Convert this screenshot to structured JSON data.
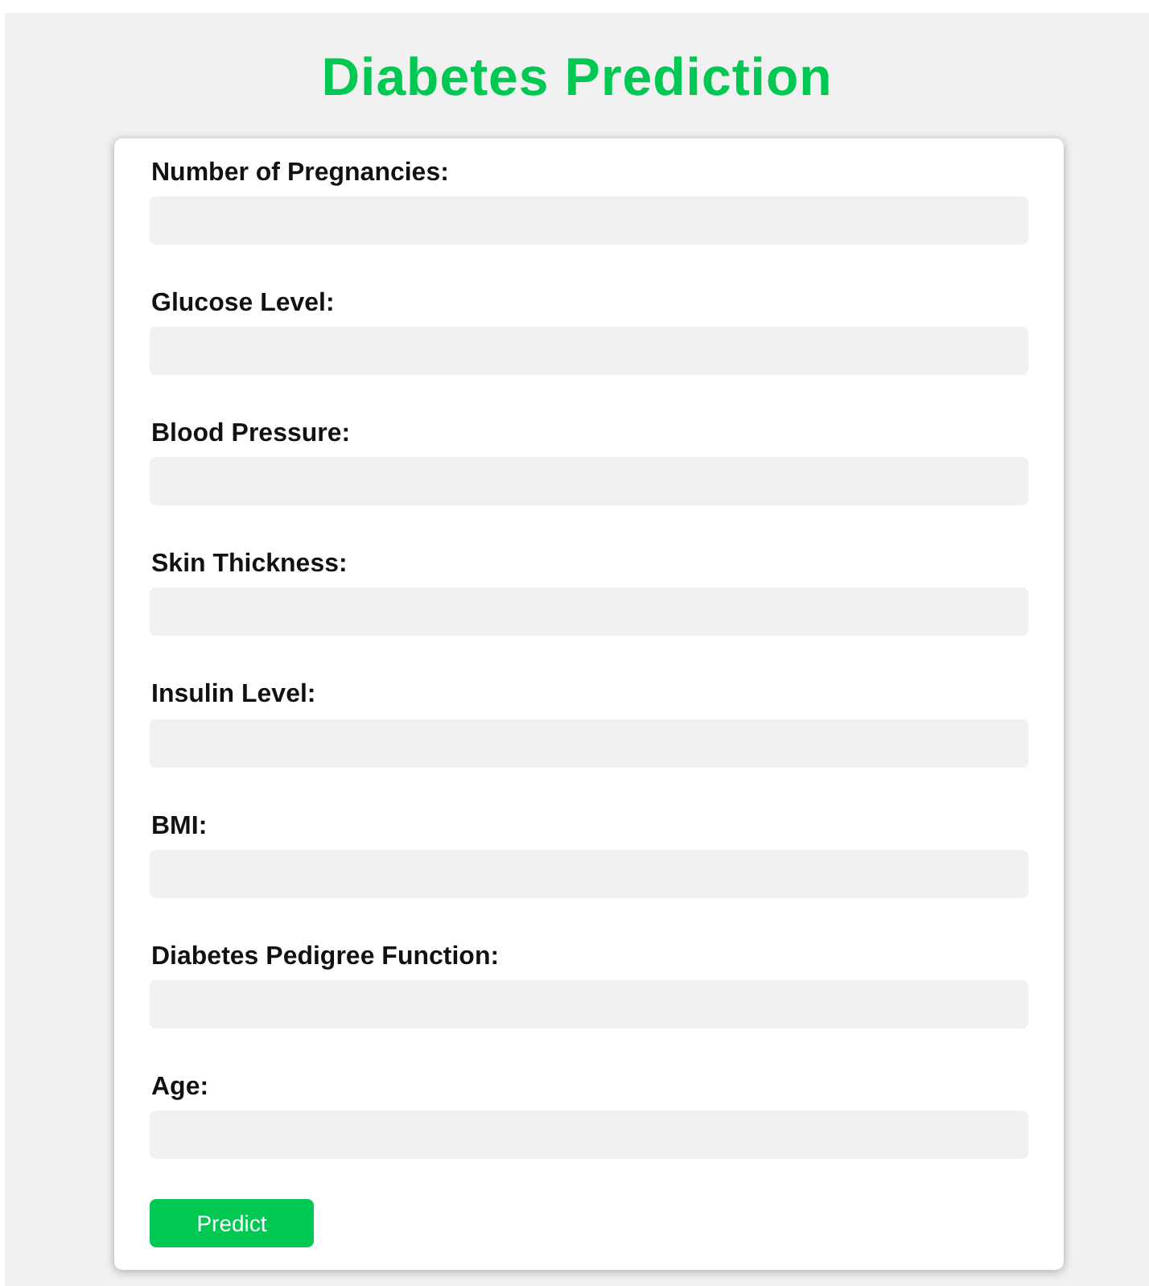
{
  "title": "Diabetes Prediction",
  "fields": [
    {
      "label": "Number of Pregnancies:"
    },
    {
      "label": "Glucose Level:"
    },
    {
      "label": "Blood Pressure:"
    },
    {
      "label": "Skin Thickness:"
    },
    {
      "label": "Insulin Level:"
    },
    {
      "label": "BMI:"
    },
    {
      "label": "Diabetes Pedigree Function:"
    },
    {
      "label": "Age:"
    }
  ],
  "button": "Predict"
}
